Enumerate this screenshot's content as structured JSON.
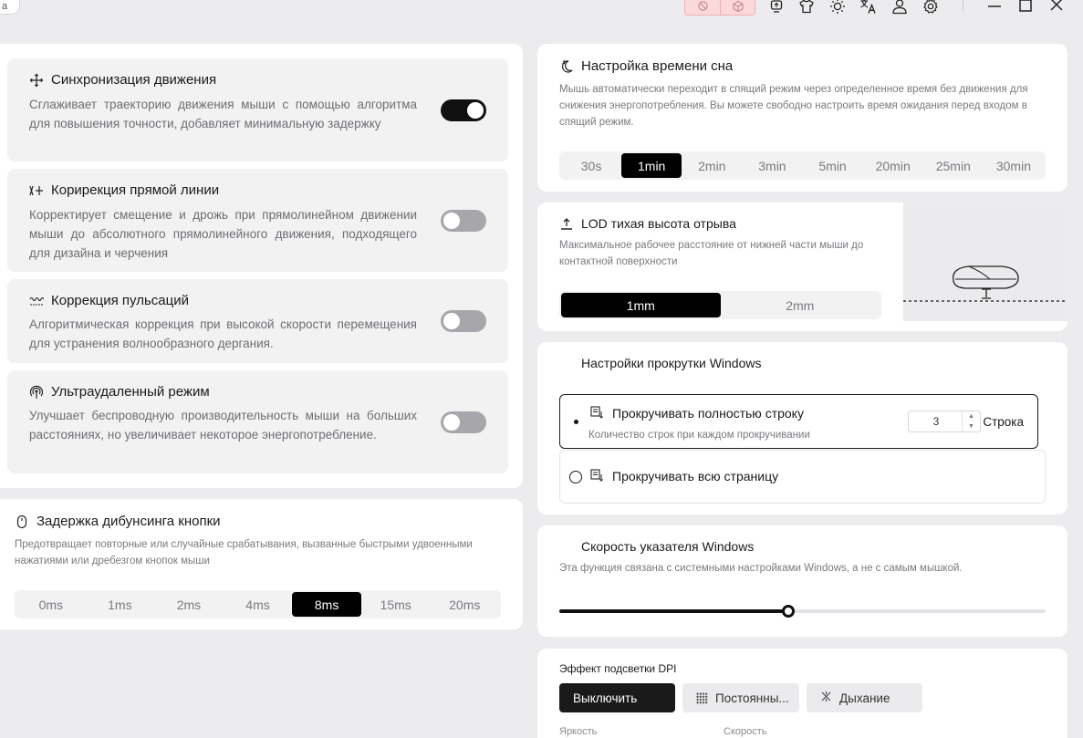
{
  "titlebar": {
    "corner_tab_label": "а",
    "icons": [
      "block-icon",
      "cube-icon",
      "monitor-icon",
      "shirt-icon",
      "sun-icon",
      "translate-icon",
      "user-icon",
      "settings-icon",
      "minimize-icon",
      "maximize-icon",
      "close-icon"
    ]
  },
  "features": [
    {
      "title": "Синхронизация движения",
      "desc": "Сглаживает траекторию движения мыши с помощью алгоритма для повышения точности, добавляет минимальную задержку",
      "enabled": true,
      "icon": "move-arrows-icon"
    },
    {
      "title": "Корирекция прямой линии",
      "desc": "Корректирует смещение и дрожь при прямолинейном движении мыши до абсолютного прямолинейного движения, подходящего для дизайна и черчения",
      "enabled": false,
      "icon": "straight-line-icon"
    },
    {
      "title": "Коррекция пульсаций",
      "desc": "Алгоритмическая коррекция при высокой скорости перемещения для устранения волнообразного дергания.",
      "enabled": false,
      "icon": "ripple-icon"
    },
    {
      "title": "Ультраудаленный режим",
      "desc": "Улучшает беспроводную производительность мыши на больших расстояниях, но увеличивает некоторое энергопотребление.",
      "enabled": false,
      "icon": "signal-icon"
    }
  ],
  "debounce": {
    "title": "Задержка дибунсинга кнопки",
    "desc": "Предотвращает повторные или случайные срабатывания, вызванные быстрыми удвоенными нажатиями или дребезгом кнопок мыши",
    "options": [
      "0ms",
      "1ms",
      "2ms",
      "4ms",
      "8ms",
      "15ms",
      "20ms"
    ],
    "selected": "8ms"
  },
  "sleep": {
    "title": "Настройка времени сна",
    "desc": "Мышь автоматически переходит в спящий режим через определенное время без движения для снижения энергопотребления. Вы можете свободно настроить время ожидания перед входом в спящий режим.",
    "options": [
      "30s",
      "1min",
      "2min",
      "3min",
      "5min",
      "20min",
      "25min",
      "30min"
    ],
    "selected": "1min"
  },
  "lod": {
    "title": "LOD тихая высота отрыва",
    "desc": "Максимальное рабочее расстояние от нижней части мыши до контактной поверхности",
    "options": [
      "1mm",
      "2mm"
    ],
    "selected": "1mm"
  },
  "scroll": {
    "title": "Настройки прокрутки Windows",
    "line_label": "Прокручивать полностью строку",
    "line_desc": "Количество строк при каждом прокручивании",
    "line_value": "3",
    "line_unit": "Строка",
    "page_label": "Прокручивать всю страницу",
    "selected": "line"
  },
  "pointer": {
    "title": "Скорость указателя Windows",
    "desc": "Эта функция связана с системными настройками Windows, а не с самым мышкой.",
    "value_fraction": 0.47
  },
  "dpi": {
    "title": "Эффект подсветки DPI",
    "buttons": [
      "Выключить",
      "Постоянны...",
      "Дыхание"
    ],
    "selected": "Выключить",
    "brightness_label": "Яркость",
    "speed_label": "Скорость"
  },
  "colors": {
    "accent": "#000000",
    "background": "#ececee",
    "card": "#ffffff",
    "feature_bg": "#f2f2f3",
    "toggle_off": "#a7a7ab",
    "pill_bg": "#fbd9db"
  }
}
